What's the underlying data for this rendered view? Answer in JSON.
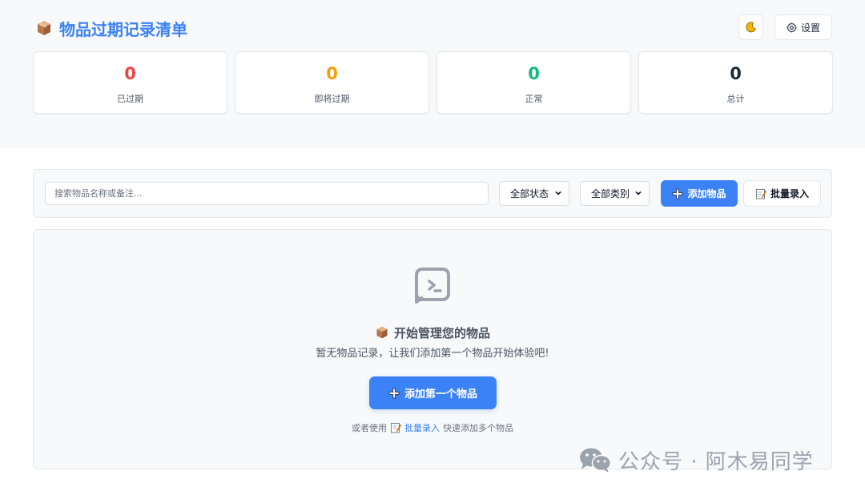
{
  "header": {
    "title": "物品过期记录清单",
    "theme_icon": "moon-icon",
    "settings_label": "设置"
  },
  "stats": [
    {
      "value": "0",
      "label": "已过期",
      "color": "#ef4444"
    },
    {
      "value": "0",
      "label": "即将过期",
      "color": "#f59e0b"
    },
    {
      "value": "0",
      "label": "正常",
      "color": "#10b981"
    },
    {
      "value": "0",
      "label": "总计",
      "color": "#1f2937"
    }
  ],
  "toolbar": {
    "search_placeholder": "搜索物品名称或备注...",
    "status_filter": "全部状态",
    "category_filter": "全部类别",
    "add_label": "添加物品",
    "batch_label": "批量录入"
  },
  "empty_state": {
    "title": "开始管理您的物品",
    "subtitle": "暂无物品记录，让我们添加第一个物品开始体验吧!",
    "cta_label": "添加第一个物品",
    "hint_prefix": "或者使用",
    "hint_link": "批量录入",
    "hint_suffix": "快速添加多个物品"
  },
  "watermark": {
    "text": "公众号 · 阿木易同学"
  },
  "colors": {
    "accent": "#3b82f6",
    "expired": "#ef4444",
    "soon": "#f59e0b",
    "normal": "#10b981"
  }
}
